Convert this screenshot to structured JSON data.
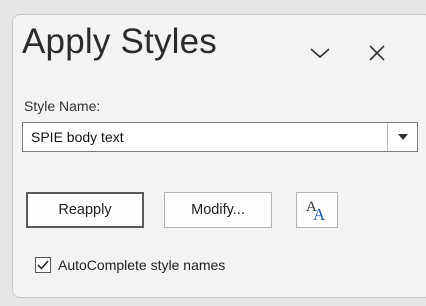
{
  "panel": {
    "title": "Apply Styles",
    "collapse_icon": "chevron-down-icon",
    "close_icon": "close-icon"
  },
  "style_name": {
    "label": "Style Name:",
    "value": "SPIE body text",
    "dropdown_icon": "triangle-down-icon"
  },
  "buttons": {
    "reapply": "Reapply",
    "modify": "Modify...",
    "styles_icon": "styles-pane-icon"
  },
  "autocomplete": {
    "label": "AutoComplete style names",
    "checked": true
  },
  "colors": {
    "accent_blue": "#1f5ea8",
    "text": "#2b2b2b",
    "panel_bg": "#f3f3f3"
  }
}
